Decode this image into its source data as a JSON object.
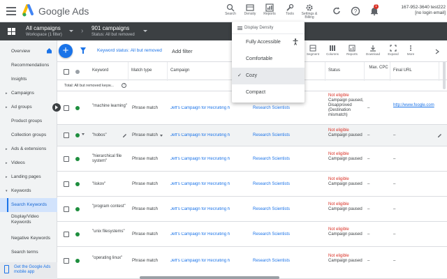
{
  "app": {
    "brand": "Google Ads"
  },
  "header_tools": [
    {
      "label": "Search",
      "icon": "search-icon"
    },
    {
      "label": "Density",
      "icon": "density-icon"
    },
    {
      "label": "Reports",
      "icon": "reports-icon"
    },
    {
      "label": "Tools",
      "icon": "tools-icon"
    },
    {
      "label": "Settings & Billing",
      "icon": "gear-icon"
    }
  ],
  "header": {
    "notif_count": "1",
    "account_id": "167-952-3640 test222",
    "account_login": "[no login email]"
  },
  "breadcrumb": {
    "workspace_title": "All campaigns",
    "workspace_sub": "Workspace (1 filter)",
    "campaigns_title": "901 campaigns",
    "campaigns_sub": "Status: All but removed"
  },
  "sidebar": {
    "items": [
      {
        "label": "Overview",
        "arrow": ""
      },
      {
        "label": "Recommendations",
        "arrow": ""
      },
      {
        "label": "Insights",
        "arrow": ""
      },
      {
        "label": "Campaigns",
        "arrow": "▸"
      },
      {
        "label": "Ad groups",
        "arrow": "▸"
      },
      {
        "label": "Product groups",
        "arrow": ""
      },
      {
        "label": "Collection groups",
        "arrow": ""
      },
      {
        "label": "Ads & extensions",
        "arrow": "▸"
      },
      {
        "label": "Videos",
        "arrow": "▸"
      },
      {
        "label": "Landing pages",
        "arrow": "▸"
      },
      {
        "label": "Keywords",
        "arrow": "▾"
      },
      {
        "label": "Search Keywords",
        "arrow": ""
      },
      {
        "label": "Display/Video Keywords",
        "arrow": ""
      },
      {
        "label": "Negative Keywords",
        "arrow": ""
      },
      {
        "label": "Search terms",
        "arrow": ""
      }
    ],
    "mobile_app": "Get the Google Ads mobile app"
  },
  "toolbar": {
    "add": "+",
    "filter_chip_prefix": "Keyword status: ",
    "filter_chip_value": "All but removed",
    "add_filter": "Add filter",
    "buttons": [
      {
        "label": "Segment",
        "icon": "segment-icon"
      },
      {
        "label": "Columns",
        "icon": "columns-icon"
      },
      {
        "label": "Reports",
        "icon": "reports-icon"
      },
      {
        "label": "Download",
        "icon": "download-icon"
      },
      {
        "label": "Expand",
        "icon": "expand-icon"
      },
      {
        "label": "More",
        "icon": "more-icon"
      }
    ]
  },
  "table": {
    "headers": [
      "Keyword",
      "Match type",
      "Campaign",
      "Ad group",
      "Status",
      "Max. CPC",
      "Final URL"
    ],
    "total_label": "Total: All but removed keyw...",
    "rows": [
      {
        "keyword": "\"machine learning\"",
        "match": "Phrase match",
        "campaign": "Jeff's Campaign for Recruiting h",
        "adgroup": "Research Scientists",
        "status_red": "Not eligible",
        "status": "Campaign paused, Disapproved (Destination mismatch)",
        "cpc": "–",
        "url": "http://www.foogle.com"
      },
      {
        "keyword": "\"hobos\"",
        "match": "Phrase match",
        "campaign": "Jeff's Campaign for Recruiting h",
        "adgroup": "Research Scientists",
        "status_red": "Not eligible",
        "status": "Campaign paused",
        "cpc": "–",
        "url": "–"
      },
      {
        "keyword": "\"hierarchical file system\"",
        "match": "Phrase match",
        "campaign": "Jeff's Campaign for Recruiting h",
        "adgroup": "Research Scientists",
        "status_red": "Not eligible",
        "status": "Campaign paused",
        "cpc": "–",
        "url": "–"
      },
      {
        "keyword": "\"liskov\"",
        "match": "Phrase match",
        "campaign": "Jeff's Campaign for Recruiting h",
        "adgroup": "Research Scientists",
        "status_red": "Not eligible",
        "status": "Campaign paused",
        "cpc": "–",
        "url": "–"
      },
      {
        "keyword": "\"program contest\"",
        "match": "Phrase match",
        "campaign": "Jeff's Campaign for Recruiting h",
        "adgroup": "Research Scientists",
        "status_red": "Not eligible",
        "status": "Campaign paused",
        "cpc": "–",
        "url": "–"
      },
      {
        "keyword": "\"unix filesystems\"",
        "match": "Phrase match",
        "campaign": "Jeff's Campaign for Recruiting h",
        "adgroup": "Research Scientists",
        "status_red": "Not eligible",
        "status": "Campaign paused",
        "cpc": "–",
        "url": "–"
      },
      {
        "keyword": "\"operating linux\"",
        "match": "Phrase match",
        "campaign": "Jeff's Campaign for Recruiting h",
        "adgroup": "Research Scientists",
        "status_red": "Not eligible",
        "status": "Campaign paused",
        "cpc": "–",
        "url": "–"
      }
    ]
  },
  "density_menu": {
    "title": "Display Density",
    "options": [
      "Fully Accessible",
      "Comfortable",
      "Cozy",
      "Compact"
    ],
    "selected": "Cozy",
    "check": "✓"
  },
  "colors": {
    "accent": "#1a73e8",
    "active_bg": "#d2e3fc",
    "error": "#d93025",
    "enabled": "#1e8e3e",
    "dark_bar": "#3c4043"
  }
}
